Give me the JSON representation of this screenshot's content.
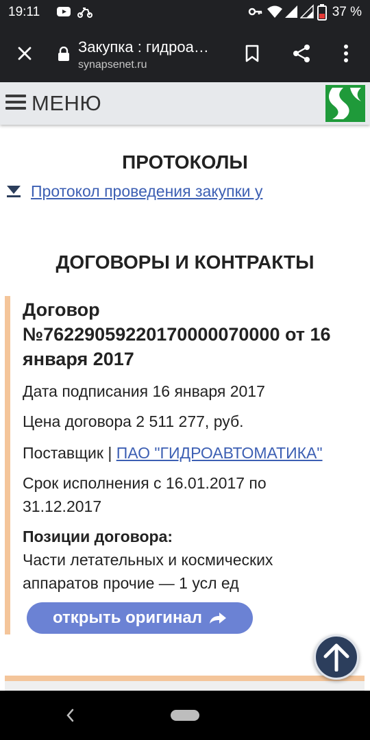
{
  "status_bar": {
    "time": "19:11",
    "battery": "37 %",
    "icons": [
      "youtube-icon",
      "delivery-scooter-icon",
      "key-icon",
      "wifi-icon",
      "signal-icon",
      "signal-icon",
      "battery-icon"
    ]
  },
  "browser": {
    "tab_title": "Закупка : гидроа…",
    "url": "synapsenet.ru",
    "icons": [
      "close-icon",
      "lock-icon",
      "bookmark-icon",
      "share-icon",
      "more-vert-icon"
    ]
  },
  "site_menu": {
    "label": "МЕНЮ",
    "brand_color": "#1f9a3a"
  },
  "protocols": {
    "heading": "ПРОТОКОЛЫ",
    "link_text": "Протокол проведения закупки у"
  },
  "contracts": {
    "heading": "ДОГОВОРЫ И КОНТРАКТЫ",
    "item": {
      "title_line1": "Договор",
      "title_line2": "№76229059220170000070000 от 16",
      "title_line3": "января 2017",
      "signed": "Дата подписания 16 января 2017",
      "price": "Цена договора 2 511 277, руб.",
      "supplier_prefix": "Поставщик | ",
      "supplier_name": "ПАО \"ГИДРОАВТОМАТИКА\"",
      "term_line1": "Срок исполнения с 16.01.2017 по",
      "term_line2": "31.12.2017",
      "positions_heading": "Позиции договора:",
      "positions_line1": "Части летательных и космических",
      "positions_line2": "аппаратов прочие — 1 усл ед",
      "open_button": "открыть оригинал"
    }
  },
  "colors": {
    "accent_link": "#3c5fb3",
    "button": "#6b82d4",
    "card_border": "#f4c59a",
    "fab": "#2c3e5c"
  }
}
